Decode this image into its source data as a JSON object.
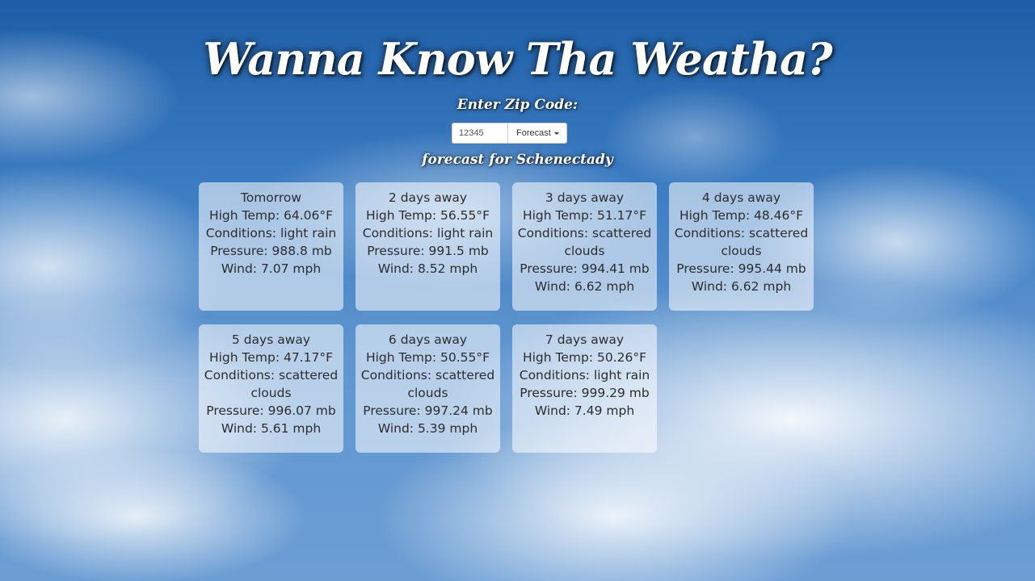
{
  "header": {
    "title": "Wanna Know Tha Weatha?",
    "zip_label": "Enter Zip Code:",
    "forecast_for": "forecast for Schenectady"
  },
  "search": {
    "zip_value": "12345",
    "button_label": "Forecast"
  },
  "days": [
    {
      "label": "Tomorrow",
      "high": "High Temp: 64.06°F",
      "conditions": "Conditions: light rain",
      "pressure": "Pressure: 988.8 mb",
      "wind": "Wind: 7.07 mph"
    },
    {
      "label": "2 days away",
      "high": "High Temp: 56.55°F",
      "conditions": "Conditions: light rain",
      "pressure": "Pressure: 991.5 mb",
      "wind": "Wind: 8.52 mph"
    },
    {
      "label": "3 days away",
      "high": "High Temp: 51.17°F",
      "conditions": "Conditions: scattered clouds",
      "pressure": "Pressure: 994.41 mb",
      "wind": "Wind: 6.62 mph"
    },
    {
      "label": "4 days away",
      "high": "High Temp: 48.46°F",
      "conditions": "Conditions: scattered clouds",
      "pressure": "Pressure: 995.44 mb",
      "wind": "Wind: 6.62 mph"
    },
    {
      "label": "5 days away",
      "high": "High Temp: 47.17°F",
      "conditions": "Conditions: scattered clouds",
      "pressure": "Pressure: 996.07 mb",
      "wind": "Wind: 5.61 mph"
    },
    {
      "label": "6 days away",
      "high": "High Temp: 50.55°F",
      "conditions": "Conditions: scattered clouds",
      "pressure": "Pressure: 997.24 mb",
      "wind": "Wind: 5.39 mph"
    },
    {
      "label": "7 days away",
      "high": "High Temp: 50.26°F",
      "conditions": "Conditions: light rain",
      "pressure": "Pressure: 999.29 mb",
      "wind": "Wind: 7.49 mph"
    }
  ]
}
